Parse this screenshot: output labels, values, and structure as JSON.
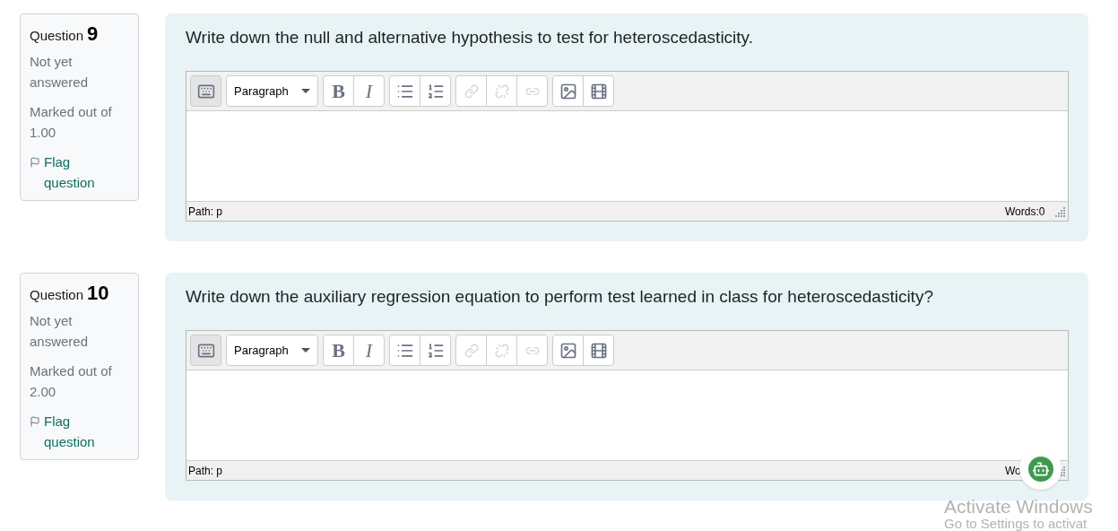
{
  "questions": [
    {
      "label": "Question",
      "number": "9",
      "status": "Not yet answered",
      "mark_label": "Marked out of",
      "mark": "1.00",
      "flag": "Flag question",
      "prompt": "Write down the null and alternative hypothesis to test for heteroscedasticity.",
      "editor": {
        "format": "Paragraph",
        "toolbar": [
          [
            {
              "kind": "toggle",
              "disabled": false
            }
          ],
          [
            {
              "kind": "bold",
              "label": "B",
              "disabled": false
            },
            {
              "kind": "italic",
              "label": "I",
              "disabled": false
            }
          ],
          [
            {
              "kind": "bullets",
              "disabled": false
            },
            {
              "kind": "numbers",
              "disabled": false
            }
          ],
          [
            {
              "kind": "link",
              "disabled": true
            },
            {
              "kind": "unlink",
              "disabled": true
            },
            {
              "kind": "anchor",
              "disabled": true
            }
          ],
          [
            {
              "kind": "image",
              "disabled": false
            },
            {
              "kind": "media",
              "disabled": false
            }
          ]
        ],
        "path": "Path: p",
        "words": "Words:0"
      }
    },
    {
      "label": "Question",
      "number": "10",
      "status": "Not yet answered",
      "mark_label": "Marked out of",
      "mark": "2.00",
      "flag": "Flag question",
      "prompt": "Write down the auxiliary regression equation to perform test learned in class for heteroscedasticity?",
      "editor": {
        "format": "Paragraph",
        "toolbar": [
          [
            {
              "kind": "toggle",
              "disabled": false
            }
          ],
          [
            {
              "kind": "bold",
              "label": "B",
              "disabled": false
            },
            {
              "kind": "italic",
              "label": "I",
              "disabled": false
            }
          ],
          [
            {
              "kind": "bullets",
              "disabled": false
            },
            {
              "kind": "numbers",
              "disabled": false
            }
          ],
          [
            {
              "kind": "link",
              "disabled": true
            },
            {
              "kind": "unlink",
              "disabled": true
            },
            {
              "kind": "anchor",
              "disabled": true
            }
          ],
          [
            {
              "kind": "image",
              "disabled": false
            },
            {
              "kind": "media",
              "disabled": false
            }
          ]
        ],
        "path": "Path: p",
        "words": "Wo"
      }
    }
  ],
  "os_notice": {
    "title": "Activate Windows",
    "subtitle": "Go to Settings to activat"
  }
}
